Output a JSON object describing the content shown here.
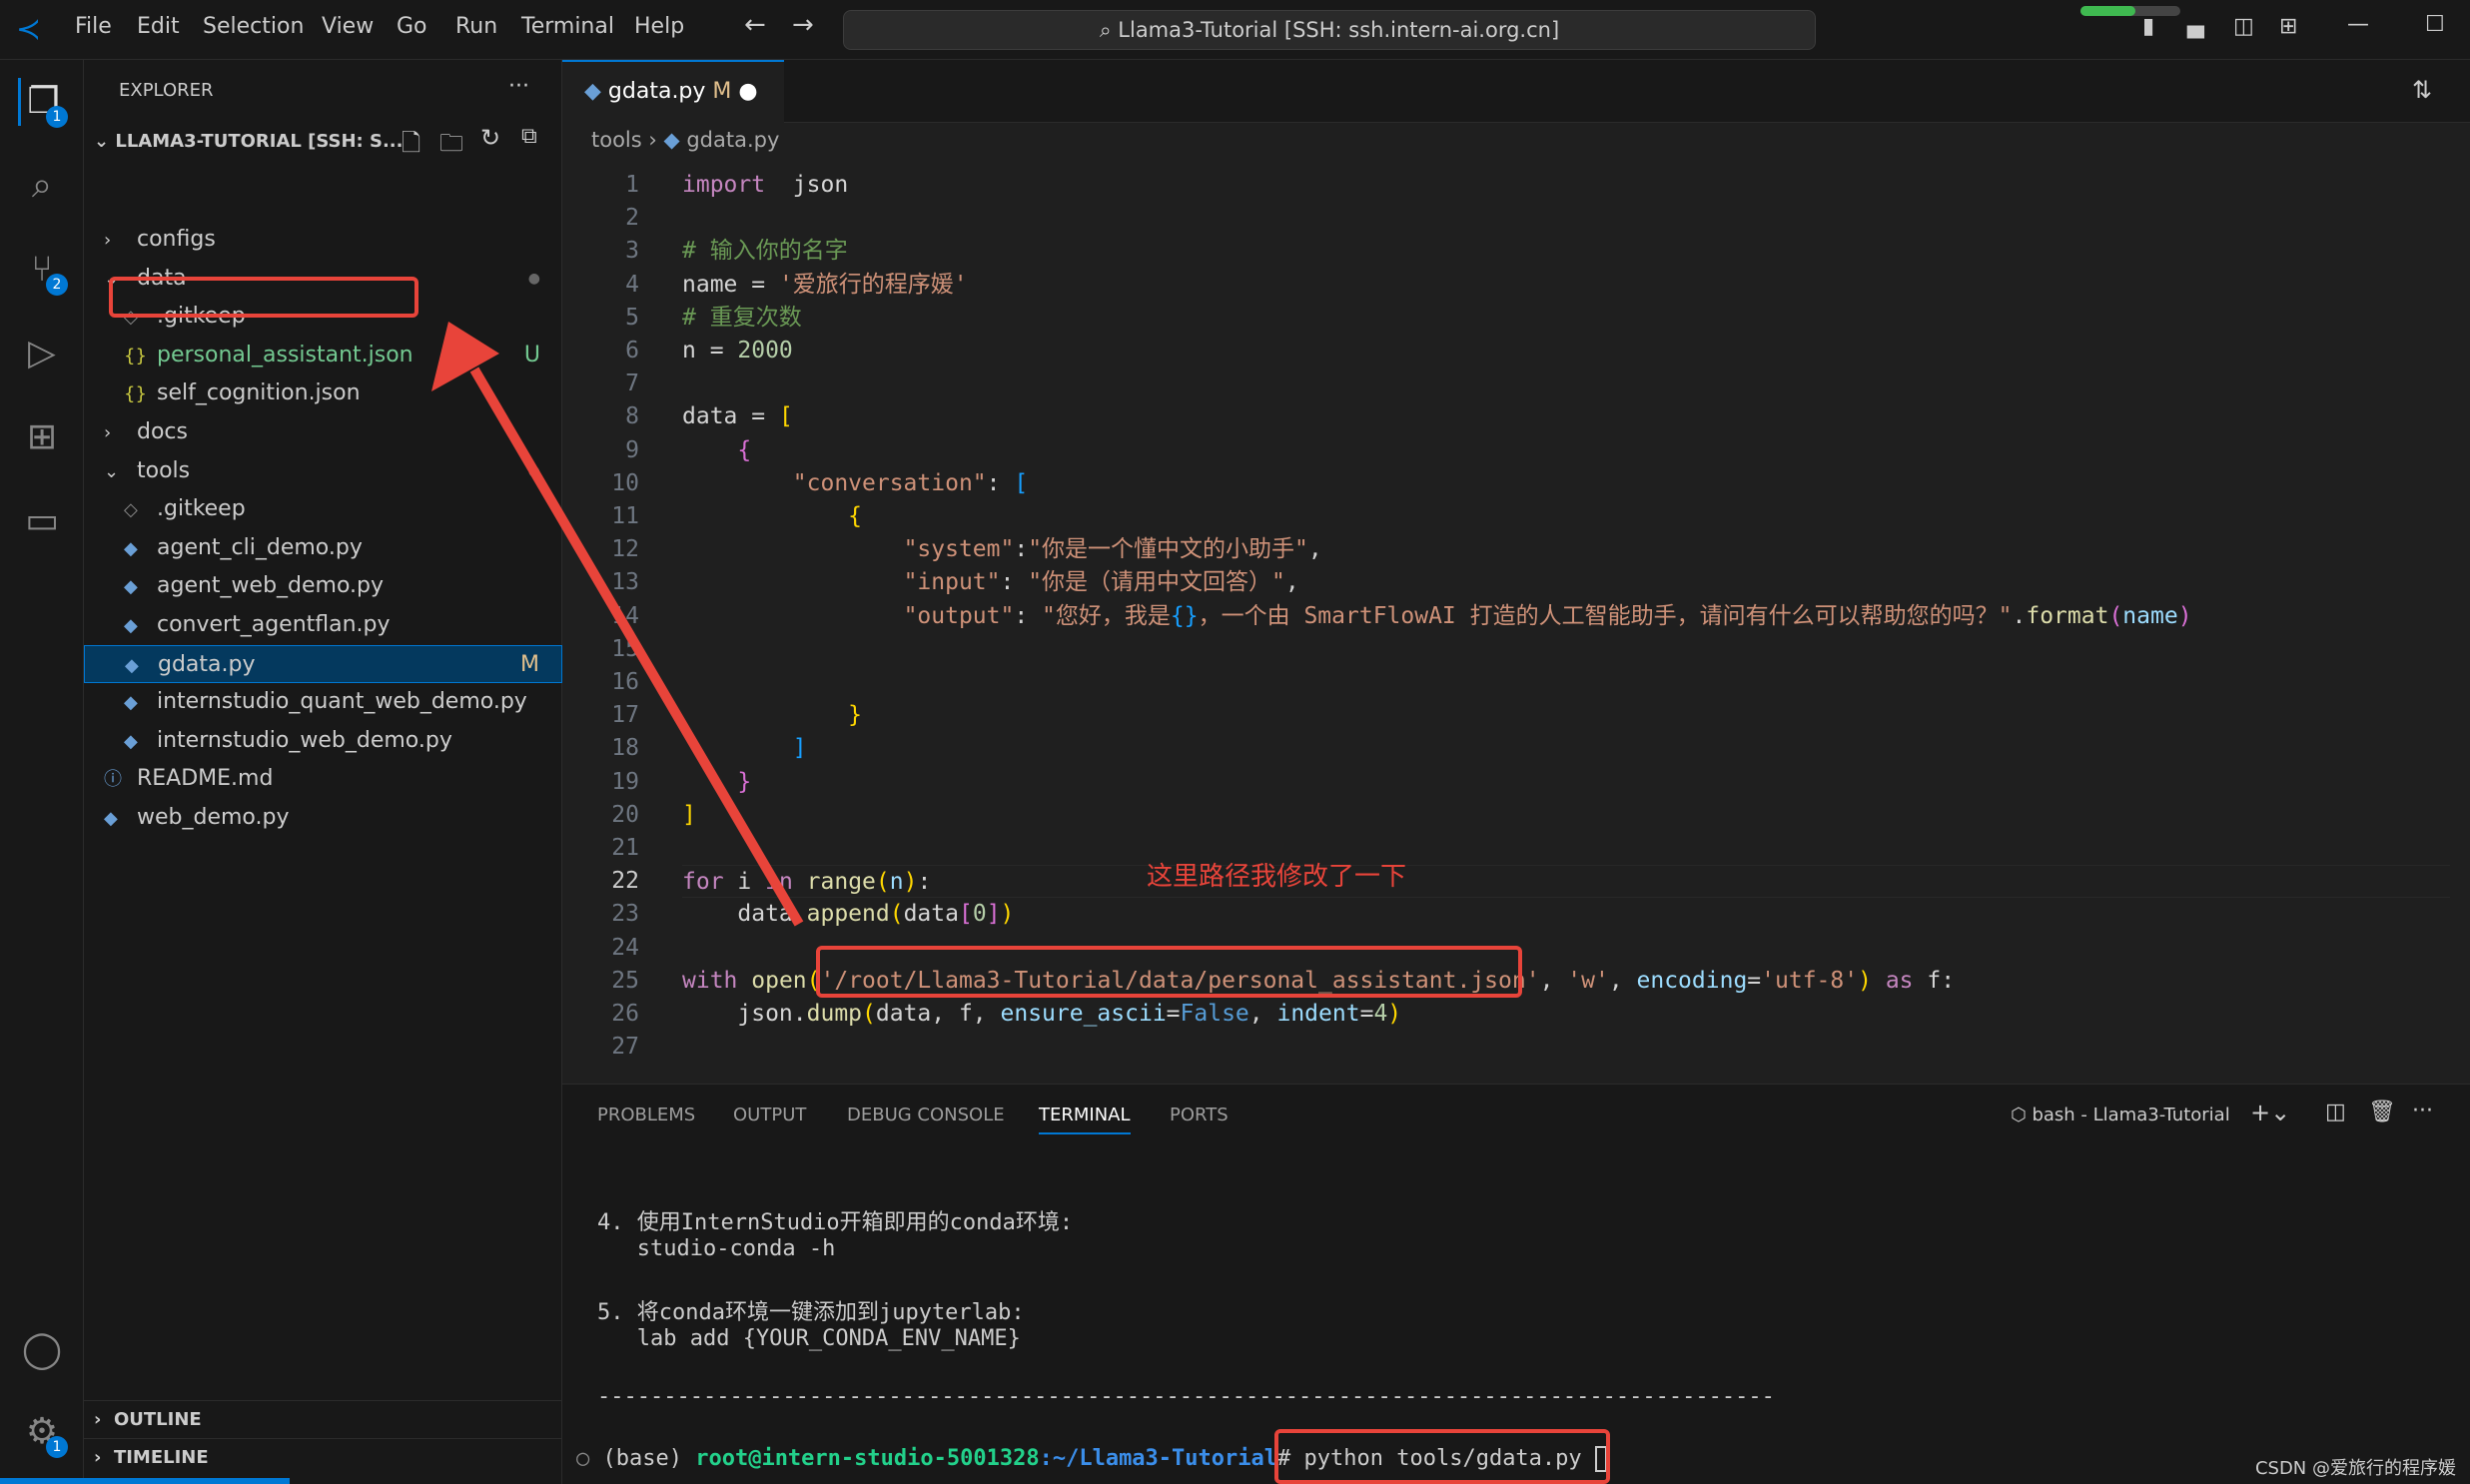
{
  "titlebar": {
    "menus": [
      "File",
      "Edit",
      "Selection",
      "View",
      "Go",
      "Run",
      "Terminal",
      "Help"
    ],
    "search": "Llama3-Tutorial [SSH: ssh.intern-ai.org.cn]"
  },
  "activity": {
    "explorer_badge": "1",
    "scm_badge": "2",
    "settings_badge": "1"
  },
  "sidebar": {
    "title": "EXPLORER",
    "root": "LLAMA3-TUTORIAL [SSH: S...",
    "outline": "OUTLINE",
    "timeline": "TIMELINE",
    "items": [
      {
        "label": "configs",
        "type": "folder",
        "open": false,
        "depth": 0
      },
      {
        "label": "data",
        "type": "folder",
        "open": true,
        "depth": 0,
        "dot": true
      },
      {
        "label": ".gitkeep",
        "type": "file",
        "depth": 1
      },
      {
        "label": "personal_assistant.json",
        "type": "json",
        "depth": 1,
        "status": "U",
        "color": "#73c991"
      },
      {
        "label": "self_cognition.json",
        "type": "json",
        "depth": 1
      },
      {
        "label": "docs",
        "type": "folder",
        "open": false,
        "depth": 0
      },
      {
        "label": "tools",
        "type": "folder",
        "open": true,
        "depth": 0,
        "dot": true
      },
      {
        "label": ".gitkeep",
        "type": "file",
        "depth": 1
      },
      {
        "label": "agent_cli_demo.py",
        "type": "py",
        "depth": 1
      },
      {
        "label": "agent_web_demo.py",
        "type": "py",
        "depth": 1
      },
      {
        "label": "convert_agentflan.py",
        "type": "py",
        "depth": 1
      },
      {
        "label": "gdata.py",
        "type": "py",
        "depth": 1,
        "status": "M",
        "selected": true
      },
      {
        "label": "internstudio_quant_web_demo.py",
        "type": "py",
        "depth": 1
      },
      {
        "label": "internstudio_web_demo.py",
        "type": "py",
        "depth": 1
      },
      {
        "label": "README.md",
        "type": "info",
        "depth": 0
      },
      {
        "label": "web_demo.py",
        "type": "py",
        "depth": 0
      }
    ]
  },
  "editor": {
    "tab": "gdata.py",
    "tab_status": "M",
    "breadcrumb": [
      "tools",
      "gdata.py"
    ],
    "current_line": 22,
    "lines": [
      [
        [
          "kw",
          "import"
        ],
        [
          "",
          "  json"
        ]
      ],
      [],
      [
        [
          "cm",
          "# 输入你的名字"
        ]
      ],
      [
        [
          "",
          "name = "
        ],
        [
          "str",
          "'爱旅行的程序媛'"
        ]
      ],
      [
        [
          "cm",
          "# 重复次数"
        ]
      ],
      [
        [
          "",
          "n = "
        ],
        [
          "num",
          "2000"
        ]
      ],
      [],
      [
        [
          "",
          "data = "
        ],
        [
          "b1",
          "["
        ]
      ],
      [
        [
          "",
          "    "
        ],
        [
          "b2",
          "{"
        ]
      ],
      [
        [
          "",
          "        "
        ],
        [
          "str",
          "\"conversation\""
        ],
        [
          "",
          ": "
        ],
        [
          "b3",
          "["
        ]
      ],
      [
        [
          "",
          "            "
        ],
        [
          "b1",
          "{"
        ]
      ],
      [
        [
          "",
          "                "
        ],
        [
          "str",
          "\"system\""
        ],
        [
          "",
          ":"
        ],
        [
          "str",
          "\"你是一个懂中文的小助手\""
        ],
        [
          "",
          ","
        ]
      ],
      [
        [
          "",
          "                "
        ],
        [
          "str",
          "\"input\""
        ],
        [
          "",
          ": "
        ],
        [
          "str",
          "\"你是（请用中文回答）\""
        ],
        [
          "",
          ","
        ]
      ],
      [
        [
          "",
          "                "
        ],
        [
          "str",
          "\"output\""
        ],
        [
          "",
          ": "
        ],
        [
          "str",
          "\"您好，我是"
        ],
        [
          "b3",
          "{}"
        ],
        [
          "str",
          "，一个由 SmartFlowAI 打造的人工智能助手，请问有什么可以帮助您的吗？\""
        ],
        [
          "",
          "."
        ],
        [
          "fn",
          "format"
        ],
        [
          "b2",
          "("
        ],
        [
          "var",
          "name"
        ],
        [
          "b2",
          ")"
        ]
      ],
      [],
      [],
      [
        [
          "",
          "            "
        ],
        [
          "b1",
          "}"
        ]
      ],
      [
        [
          "",
          "        "
        ],
        [
          "b3",
          "]"
        ]
      ],
      [
        [
          "",
          "    "
        ],
        [
          "b2",
          "}"
        ]
      ],
      [
        [
          "b1",
          "]"
        ]
      ],
      [],
      [
        [
          "kw",
          "for"
        ],
        [
          "",
          " i "
        ],
        [
          "kw",
          "in"
        ],
        [
          "",
          " "
        ],
        [
          "fn",
          "range"
        ],
        [
          "b1",
          "("
        ],
        [
          "var",
          "n"
        ],
        [
          "b1",
          ")"
        ],
        [
          "",
          ":"
        ]
      ],
      [
        [
          "",
          "    data."
        ],
        [
          "fn",
          "append"
        ],
        [
          "b1",
          "("
        ],
        [
          "",
          "data"
        ],
        [
          "b2",
          "["
        ],
        [
          "num",
          "0"
        ],
        [
          "b2",
          "]"
        ],
        [
          "b1",
          ")"
        ]
      ],
      [],
      [
        [
          "kw",
          "with"
        ],
        [
          "",
          " "
        ],
        [
          "fn",
          "open"
        ],
        [
          "b1",
          "("
        ],
        [
          "str",
          "'/root/Llama3-Tutorial/data/personal_assistant.json'"
        ],
        [
          "",
          ", "
        ],
        [
          "str",
          "'w'"
        ],
        [
          "",
          ", "
        ],
        [
          "var",
          "encoding"
        ],
        [
          "",
          "="
        ],
        [
          "str",
          "'utf-8'"
        ],
        [
          "b1",
          ")"
        ],
        [
          "",
          " "
        ],
        [
          "kw",
          "as"
        ],
        [
          "",
          " f:"
        ]
      ],
      [
        [
          "",
          "    json."
        ],
        [
          "fn",
          "dump"
        ],
        [
          "b1",
          "("
        ],
        [
          "",
          "data, f, "
        ],
        [
          "var",
          "ensure_ascii"
        ],
        [
          "",
          "="
        ],
        [
          "const",
          "False"
        ],
        [
          "",
          ", "
        ],
        [
          "var",
          "indent"
        ],
        [
          "",
          "="
        ],
        [
          "num",
          "4"
        ],
        [
          "b1",
          ")"
        ]
      ],
      []
    ]
  },
  "annotation": {
    "note": "这里路径我修改了一下",
    "color": "#e8443a"
  },
  "panel": {
    "tabs": [
      "PROBLEMS",
      "OUTPUT",
      "DEBUG CONSOLE",
      "TERMINAL",
      "PORTS"
    ],
    "active": "TERMINAL",
    "terminal_name": "bash - Llama3-Tutorial",
    "lines": [
      "4. 使用InternStudio开箱即用的conda环境:",
      "   studio-conda -h",
      "5. 将conda环境一键添加到jupyterlab:",
      "   lab add {YOUR_CONDA_ENV_NAME}",
      "-----------------------------------------------------------------------------------------"
    ],
    "prompt_env": "(base) ",
    "prompt_user": "root@intern-studio-5001328",
    "prompt_path": ":~/Llama3-Tutorial",
    "prompt_hash": "#",
    "command": " python tools/gdata.py "
  },
  "watermark": "CSDN @爱旅行的程序媛"
}
